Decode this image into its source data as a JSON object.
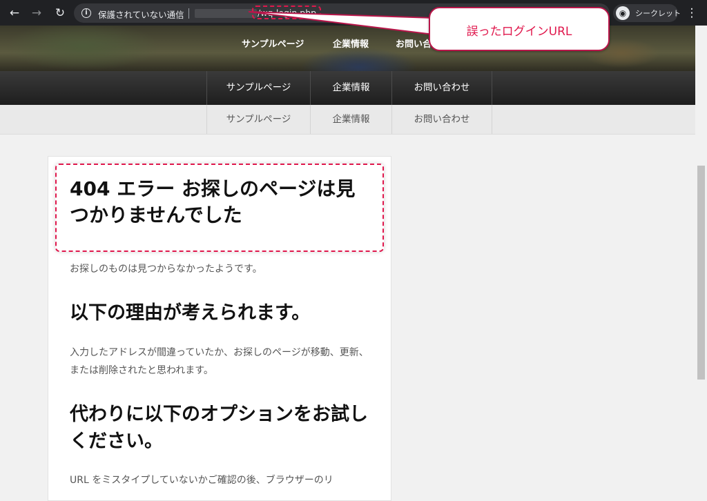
{
  "browser": {
    "security_text": "保護されていない通信",
    "url_path": "/wq-login.php",
    "incognito_label": "シークレット"
  },
  "callout": {
    "text": "誤ったログインURL"
  },
  "hero_nav": [
    "サンプルページ",
    "企業情報",
    "お問い合"
  ],
  "nav": [
    "サンプルページ",
    "企業情報",
    "お問い合わせ"
  ],
  "subnav": [
    "サンプルページ",
    "企業情報",
    "お問い合わせ"
  ],
  "content": {
    "title": "404 エラー お探しのページは見つかりませんでした",
    "intro": "お探しのものは見つからなかったようです。",
    "heading_reasons": "以下の理由が考えられます。",
    "reasons_text": "入力したアドレスが間違っていたか、お探しのページが移動、更新、または削除されたと思われます。",
    "heading_options": "代わりに以下のオプションをお試しください。",
    "options_text": "URL をミスタイプしていないかご確認の後、ブラウザーのリ"
  },
  "colors": {
    "annotation": "#e0174c",
    "chrome": "#202124"
  }
}
